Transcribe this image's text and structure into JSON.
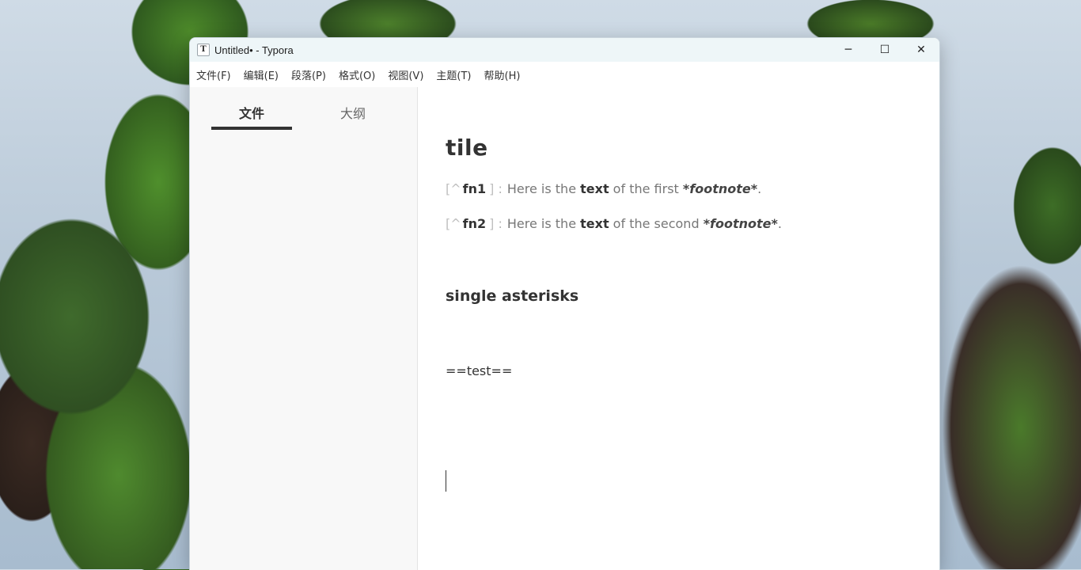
{
  "window": {
    "title": "Untitled• - Typora",
    "app_icon_letter": "T",
    "controls": {
      "minimize": "─",
      "maximize": "☐",
      "close": "✕"
    }
  },
  "menu": {
    "items": [
      "文件(F)",
      "编辑(E)",
      "段落(P)",
      "格式(O)",
      "视图(V)",
      "主题(T)",
      "帮助(H)"
    ]
  },
  "sidebar": {
    "tabs": [
      {
        "label": "文件",
        "active": true
      },
      {
        "label": "大纲",
        "active": false
      }
    ]
  },
  "document": {
    "heading": "tile",
    "footnotes": [
      {
        "open": "[^",
        "id": "fn1",
        "close": "]",
        "colon": ":",
        "pre": "Here is the ",
        "bold": "text",
        "mid": " of the first ",
        "em": "*footnote*",
        "post": "."
      },
      {
        "open": "[^",
        "id": "fn2",
        "close": "]",
        "colon": ":",
        "pre": "Here is the ",
        "bold": "text",
        "mid": " of the second ",
        "em": "*footnote*",
        "post": "."
      }
    ],
    "subheading": "single asterisks",
    "paragraph": "==test=="
  }
}
